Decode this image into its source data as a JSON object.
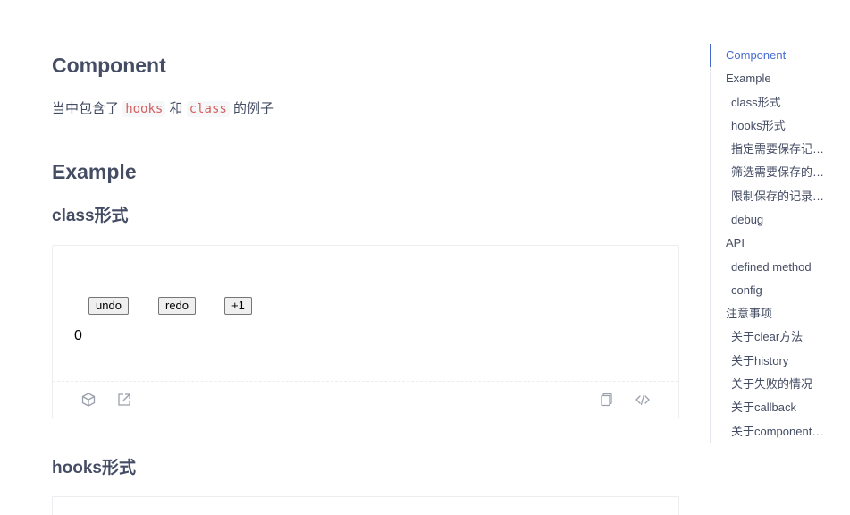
{
  "main": {
    "title": "Component",
    "intro": {
      "prefix": "当中包含了",
      "code1": "hooks",
      "mid": "和",
      "code2": "class",
      "suffix": "的例子"
    },
    "example_heading": "Example",
    "class_heading": "class形式",
    "hooks_heading": "hooks形式",
    "demo": {
      "undo_label": "undo",
      "redo_label": "redo",
      "plus_label": "+1",
      "count": "0",
      "actions": [
        "codesandbox-icon",
        "external-link-icon",
        "copy-icon",
        "code-icon"
      ]
    }
  },
  "toc": {
    "items": [
      {
        "label": "Component",
        "level": 1,
        "active": true
      },
      {
        "label": "Example",
        "level": 1
      },
      {
        "label": "class形式",
        "level": 2
      },
      {
        "label": "hooks形式",
        "level": 2
      },
      {
        "label": "指定需要保存记录的数据",
        "level": 2
      },
      {
        "label": "筛选需要保存的数据",
        "level": 2
      },
      {
        "label": "限制保存的记录数量",
        "level": 2
      },
      {
        "label": "debug",
        "level": 2
      },
      {
        "label": "API",
        "level": 1
      },
      {
        "label": "defined method",
        "level": 2
      },
      {
        "label": "config",
        "level": 2
      },
      {
        "label": "注意事项",
        "level": 1
      },
      {
        "label": "关于clear方法",
        "level": 2
      },
      {
        "label": "关于history",
        "level": 2
      },
      {
        "label": "关于失败的情况",
        "level": 2
      },
      {
        "label": "关于callback",
        "level": 2
      },
      {
        "label": "关于componentDidUpdate",
        "level": 2
      }
    ]
  },
  "colors": {
    "accent": "#4569d4",
    "text": "#454d64",
    "code": "#d56161"
  }
}
